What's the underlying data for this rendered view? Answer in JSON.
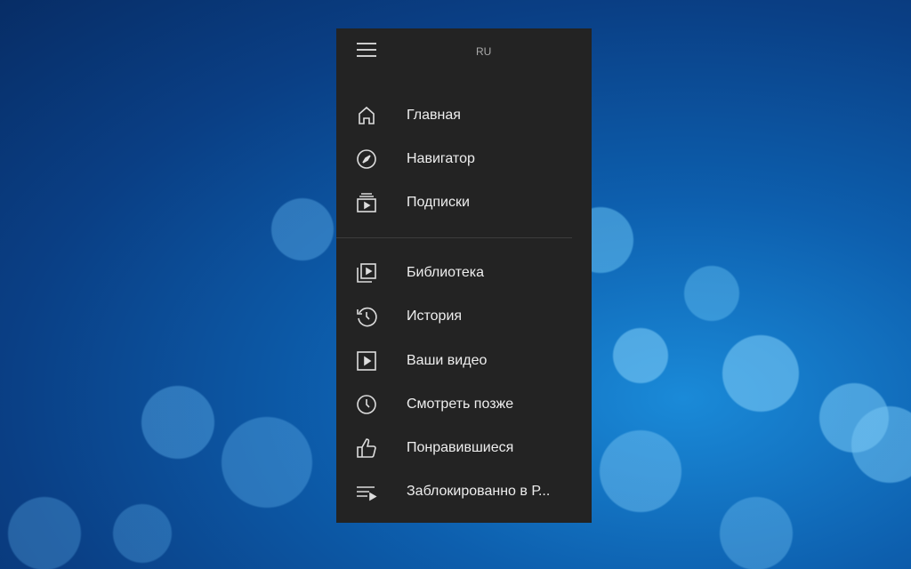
{
  "header": {
    "language": "RU"
  },
  "menu": {
    "main": [
      {
        "label": "Главная",
        "icon": "home-icon"
      },
      {
        "label": "Навигатор",
        "icon": "compass-icon"
      },
      {
        "label": "Подписки",
        "icon": "subscriptions-icon"
      }
    ],
    "library": [
      {
        "label": "Библиотека",
        "icon": "library-icon"
      },
      {
        "label": "История",
        "icon": "history-icon"
      },
      {
        "label": "Ваши видео",
        "icon": "your-videos-icon"
      },
      {
        "label": "Смотреть позже",
        "icon": "watch-later-icon"
      },
      {
        "label": "Понравившиеся",
        "icon": "thumbs-up-icon"
      },
      {
        "label": "Заблокированно в Р...",
        "icon": "playlist-icon"
      }
    ]
  }
}
